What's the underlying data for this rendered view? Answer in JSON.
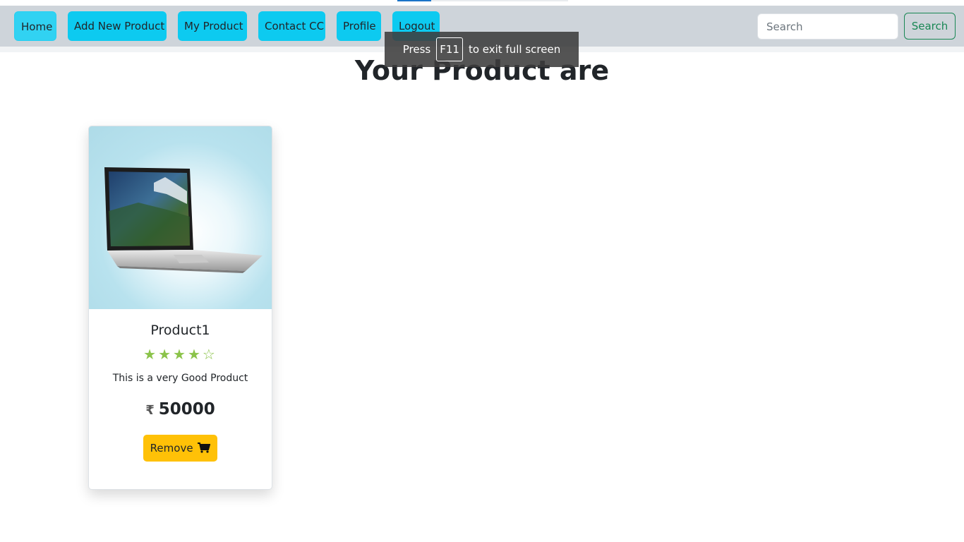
{
  "navbar": {
    "items": [
      {
        "label": "Home"
      },
      {
        "label": "Add New Product"
      },
      {
        "label": "My Product"
      },
      {
        "label": "Contact CC"
      },
      {
        "label": "Profile"
      },
      {
        "label": "Logout"
      }
    ],
    "search": {
      "placeholder": "Search",
      "button_label": "Search"
    }
  },
  "fullscreen_toast": {
    "prefix": "Press",
    "key": "F11",
    "suffix": "to exit full screen"
  },
  "page": {
    "title": "Your Product are"
  },
  "product_card": {
    "name": "Product1",
    "rating": {
      "value": 4,
      "max": 5
    },
    "description": "This is a very Good Product",
    "currency_symbol": "₹",
    "price": "50000",
    "remove_label": "Remove"
  },
  "icons": {
    "cart": "cart-icon",
    "star": "star-icon",
    "product_image": "laptop-image"
  },
  "colors": {
    "navbar_bg": "#ced4da",
    "nav_button": "#0dcaf0",
    "search_button": "#198754",
    "remove_button": "#ffc107",
    "star": "#8bc34a"
  }
}
